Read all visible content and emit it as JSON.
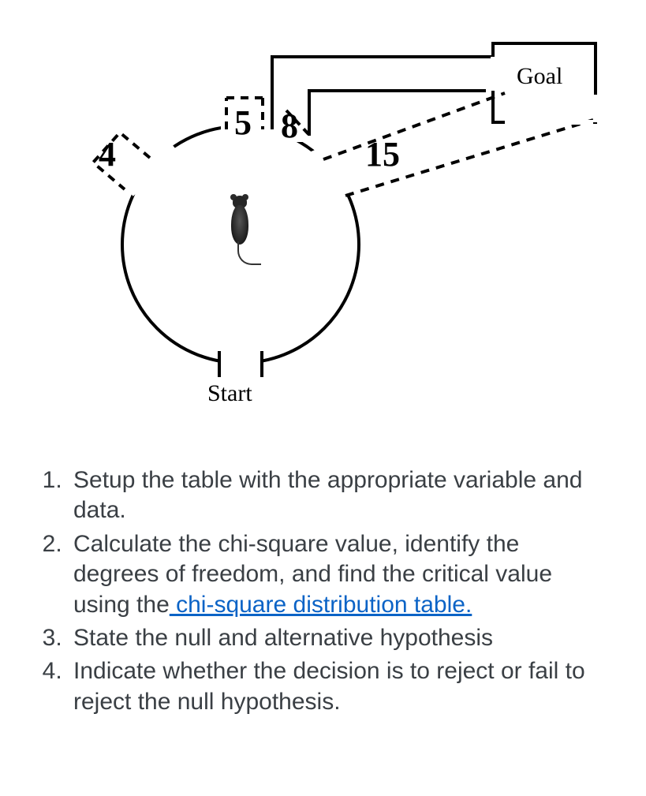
{
  "diagram": {
    "goal_label": "Goal",
    "start_label": "Start",
    "path_values": {
      "v1": "4",
      "v2": "5",
      "v3": "8",
      "v4": "15"
    }
  },
  "questions": {
    "q1": "Setup the table with the appropriate variable and data.",
    "q2_pre": "Calculate the chi-square value, identify the degrees of freedom, and find the critical value using the",
    "q2_link": " chi-square distribution table.",
    "q3": "State the null and alternative hypothesis",
    "q4": "Indicate whether the decision is to reject or fail to reject the null hypothesis."
  }
}
